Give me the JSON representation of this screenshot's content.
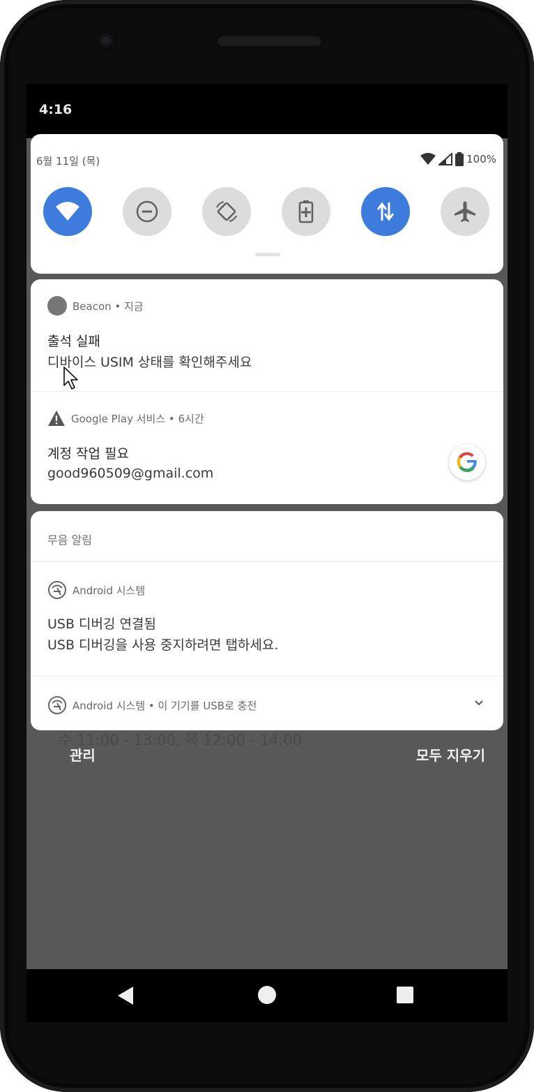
{
  "status_bar": {
    "time": "4:16"
  },
  "quick_settings": {
    "date": "6월 11일 (목)",
    "battery": "100%",
    "tiles": [
      {
        "name": "wifi",
        "active": true
      },
      {
        "name": "do-not-disturb",
        "active": false
      },
      {
        "name": "auto-rotate",
        "active": false
      },
      {
        "name": "battery-saver",
        "active": false
      },
      {
        "name": "mobile-data",
        "active": true
      },
      {
        "name": "airplane-mode",
        "active": false
      }
    ],
    "colors": {
      "active": "#3d7bdc",
      "inactive": "#dcdcdc"
    }
  },
  "notifications": {
    "beacon": {
      "app": "Beacon • 지금",
      "title": "출석 실패",
      "text": "디바이스 USIM 상태를 확인해주세요"
    },
    "google_play": {
      "app": "Google Play 서비스 • 6시간",
      "title": "계정 작업 필요",
      "text": "good960509@gmail.com"
    }
  },
  "silent": {
    "header": "무음 알림",
    "usb_debug": {
      "app": "Android 시스템",
      "title": "USB 디버깅 연결됨",
      "text": "USB 디버깅을 사용 중지하려면 탭하세요."
    },
    "usb_charge": {
      "app": "Android 시스템 • 이 기기를 USB로 충전"
    }
  },
  "background": {
    "partial_text": "수 11:00 - 13:00, 목 12:00 - 14:00"
  },
  "footer": {
    "manage": "관리",
    "clear_all": "모두 지우기"
  }
}
